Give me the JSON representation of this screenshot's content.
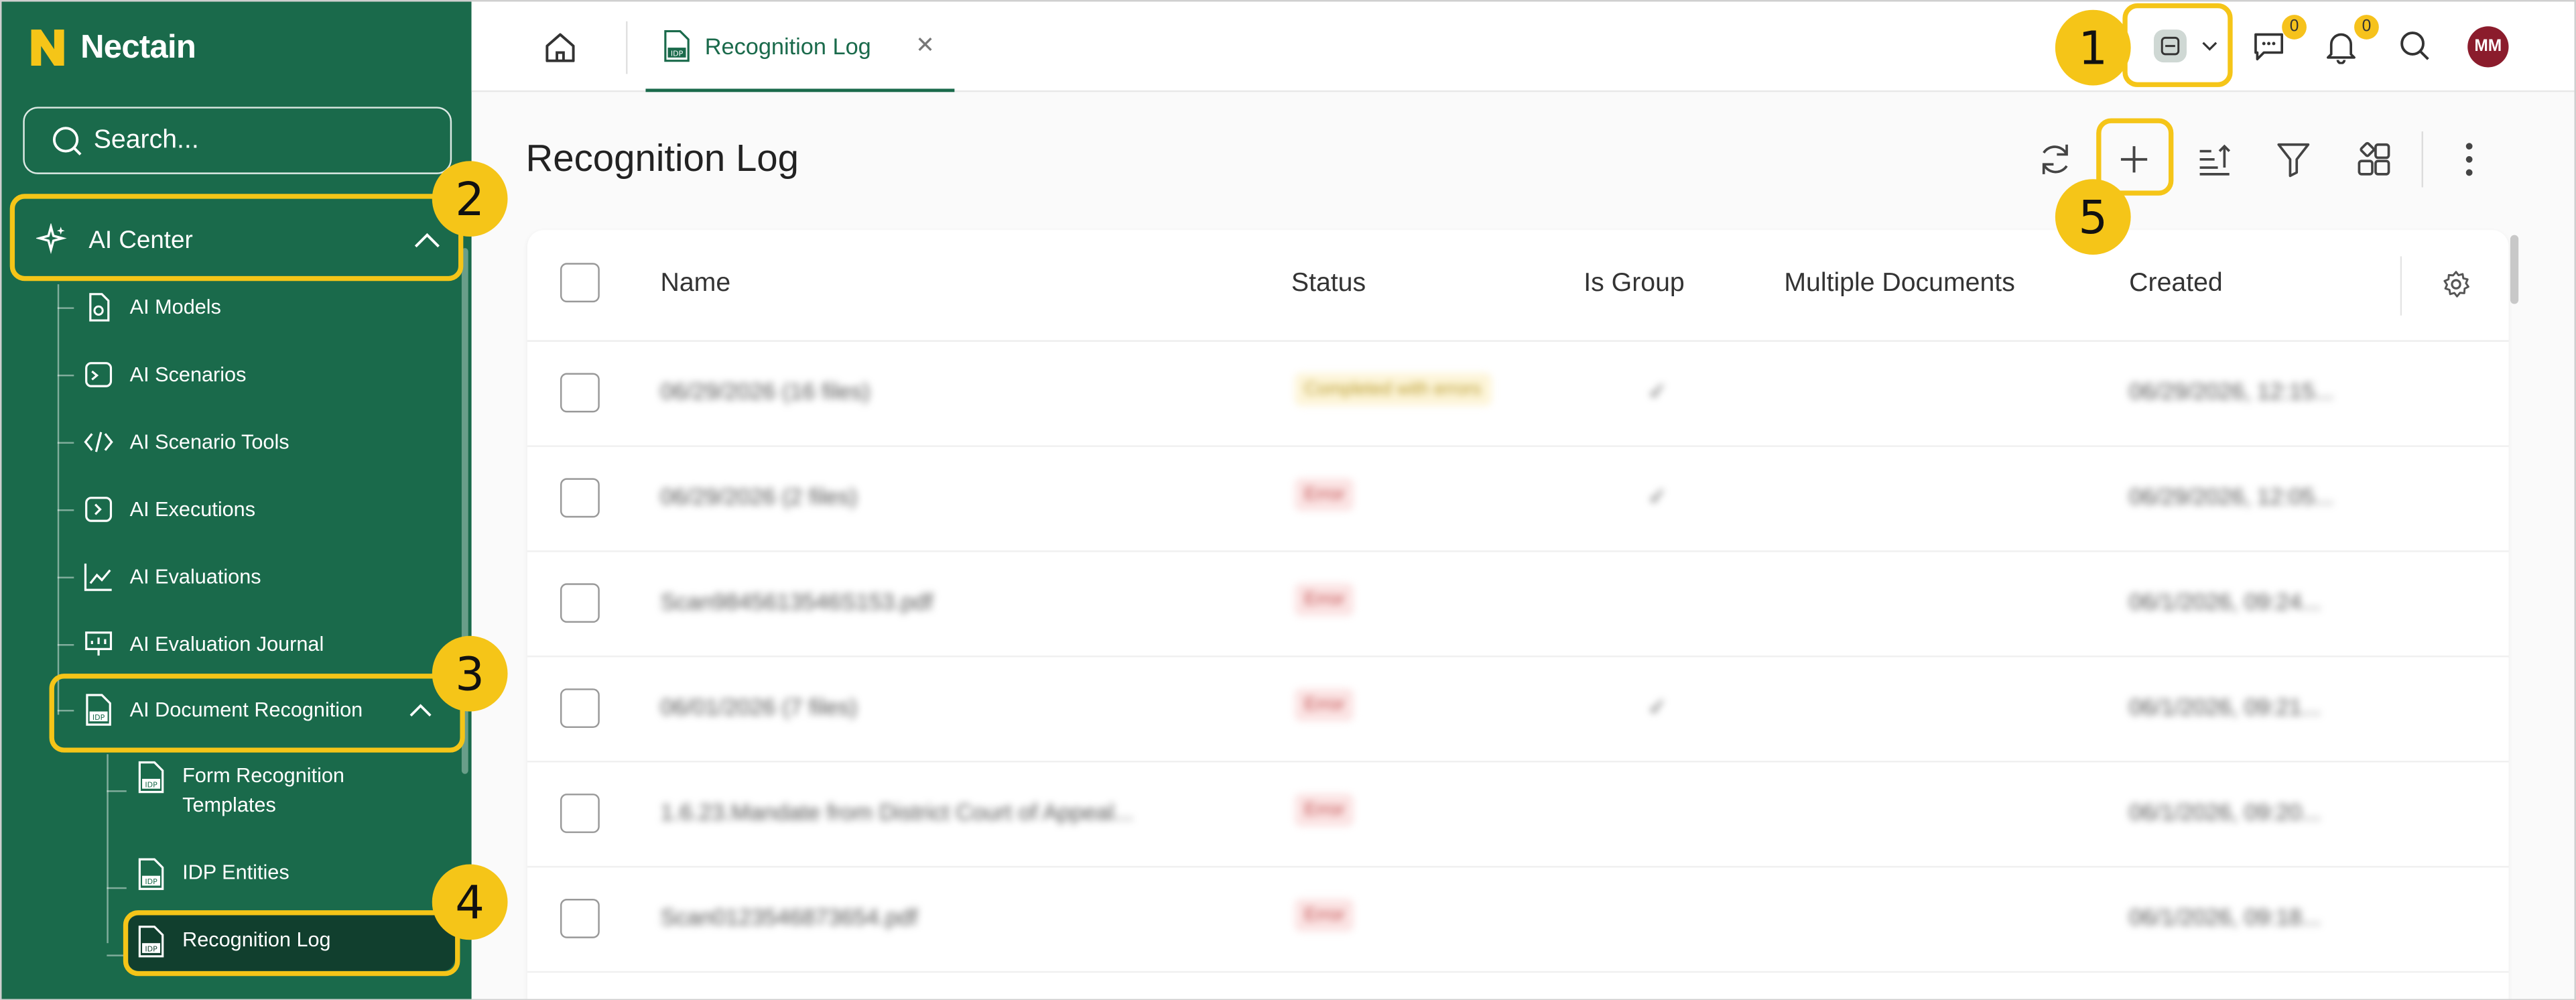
{
  "app": {
    "name": "Nectain"
  },
  "sidebar": {
    "search_placeholder": "Search...",
    "main_item": "AI Center",
    "items": [
      {
        "label": "AI Models",
        "icon": "ai-model-icon"
      },
      {
        "label": "AI Scenarios",
        "icon": "terminal-icon"
      },
      {
        "label": "AI Scenario Tools",
        "icon": "code-icon"
      },
      {
        "label": "AI Executions",
        "icon": "execute-icon"
      },
      {
        "label": "AI Evaluations",
        "icon": "line-chart-icon"
      },
      {
        "label": "AI Evaluation Journal",
        "icon": "presentation-chart-icon"
      },
      {
        "label": "AI Document Recognition",
        "icon": "idp-document-icon"
      }
    ],
    "subitems": [
      {
        "label": "Form Recognition Templates",
        "icon": "idp-document-icon"
      },
      {
        "label": "IDP Entities",
        "icon": "idp-document-icon"
      },
      {
        "label": "Recognition Log",
        "icon": "idp-document-icon"
      }
    ]
  },
  "topbar": {
    "tab_label": "Recognition Log",
    "chat_count": "0",
    "notif_count": "0",
    "avatar_initials": "MM"
  },
  "page": {
    "title": "Recognition Log"
  },
  "table": {
    "columns": [
      "Name",
      "Status",
      "Is Group",
      "Multiple Documents",
      "Created"
    ],
    "rows": [
      {
        "name": "06/29/2026 (16 files)",
        "status": "Completed with errors",
        "status_kind": "done",
        "is_group": "✓",
        "created": "06/29/2026, 12:15..."
      },
      {
        "name": "06/29/2026 (2 files)",
        "status": "Error",
        "status_kind": "err",
        "is_group": "✓",
        "created": "06/29/2026, 12:05..."
      },
      {
        "name": "Scan9845613546S153.pdf",
        "status": "Error",
        "status_kind": "err",
        "is_group": "",
        "created": "06/1/2026, 09:24..."
      },
      {
        "name": "06/01/2026 (7 files)",
        "status": "Error",
        "status_kind": "err",
        "is_group": "✓",
        "created": "06/1/2026, 09:21..."
      },
      {
        "name": "1.6.23.Mandate from District Court of Appeal...",
        "status": "Error",
        "status_kind": "err",
        "is_group": "",
        "created": "06/1/2026, 09:20..."
      },
      {
        "name": "Scan0123546873654.pdf",
        "status": "Error",
        "status_kind": "err",
        "is_group": "",
        "created": "06/1/2026, 09:18..."
      }
    ]
  },
  "callouts": [
    "1",
    "2",
    "3",
    "4",
    "5"
  ],
  "colors": {
    "sidebar": "#1a6a4b",
    "active": "#113f2e",
    "accent": "#f5c518",
    "avatar": "#8b1c2c"
  }
}
